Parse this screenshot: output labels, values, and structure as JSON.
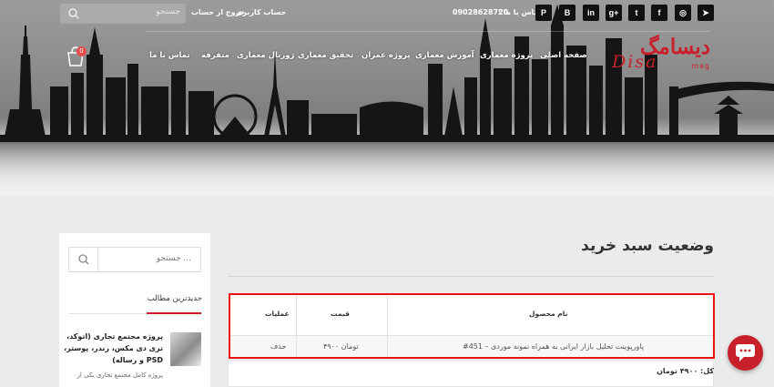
{
  "colors": {
    "accent": "#c8202a",
    "highlight_border": "#ee1111",
    "header_gray": "#8a8a8a"
  },
  "topbar": {
    "search_placeholder": "جستجو",
    "logout": "خروج از حساب",
    "account": "حساب کاربری",
    "phone": "09028628720",
    "contact_label": ": تماس با ما",
    "social_icons": [
      "pinterest-icon",
      "blogger-icon",
      "linkedin-icon",
      "google-plus-icon",
      "twitter-icon",
      "facebook-icon",
      "instagram-icon",
      "telegram-icon"
    ],
    "social_glyphs": [
      "P",
      "B",
      "in",
      "g+",
      "t",
      "f",
      "◎",
      "➤"
    ]
  },
  "nav": {
    "items": [
      "صفحه اصلی",
      "پروژه معماری",
      "آموزش معماری",
      "پروژه عمران",
      "تحقیق معماری",
      "ژورنال معماری",
      "متفرقه",
      "تماس با ما"
    ],
    "cart_count": "0"
  },
  "logo": {
    "main": "دیسامگ",
    "sub": "Disa",
    "mag": "mag"
  },
  "main": {
    "page_title": "وضعیت سبد خرید",
    "table": {
      "headers": {
        "product": "نام محصول",
        "price": "قیمت",
        "actions": "عملیات"
      },
      "row": {
        "product": "#451 – پاورپوینت تحلیل بازار ایرانی به همراه نمونه موردی",
        "price": "۴۹۰۰ تومان",
        "action": "حذف"
      }
    },
    "total": "کل: ۴۹۰۰ تومان"
  },
  "sidebar": {
    "search_placeholder": "جستجو ...",
    "heading": "جدیدترین مطالب",
    "post_title": "پروژه مجتمع تجاری (اتوکد، تری دی مکس، رندر، پوستر، PSD و رساله)",
    "post_excerpt": "پروژه کامل مجتمع تجاری یکی از"
  }
}
